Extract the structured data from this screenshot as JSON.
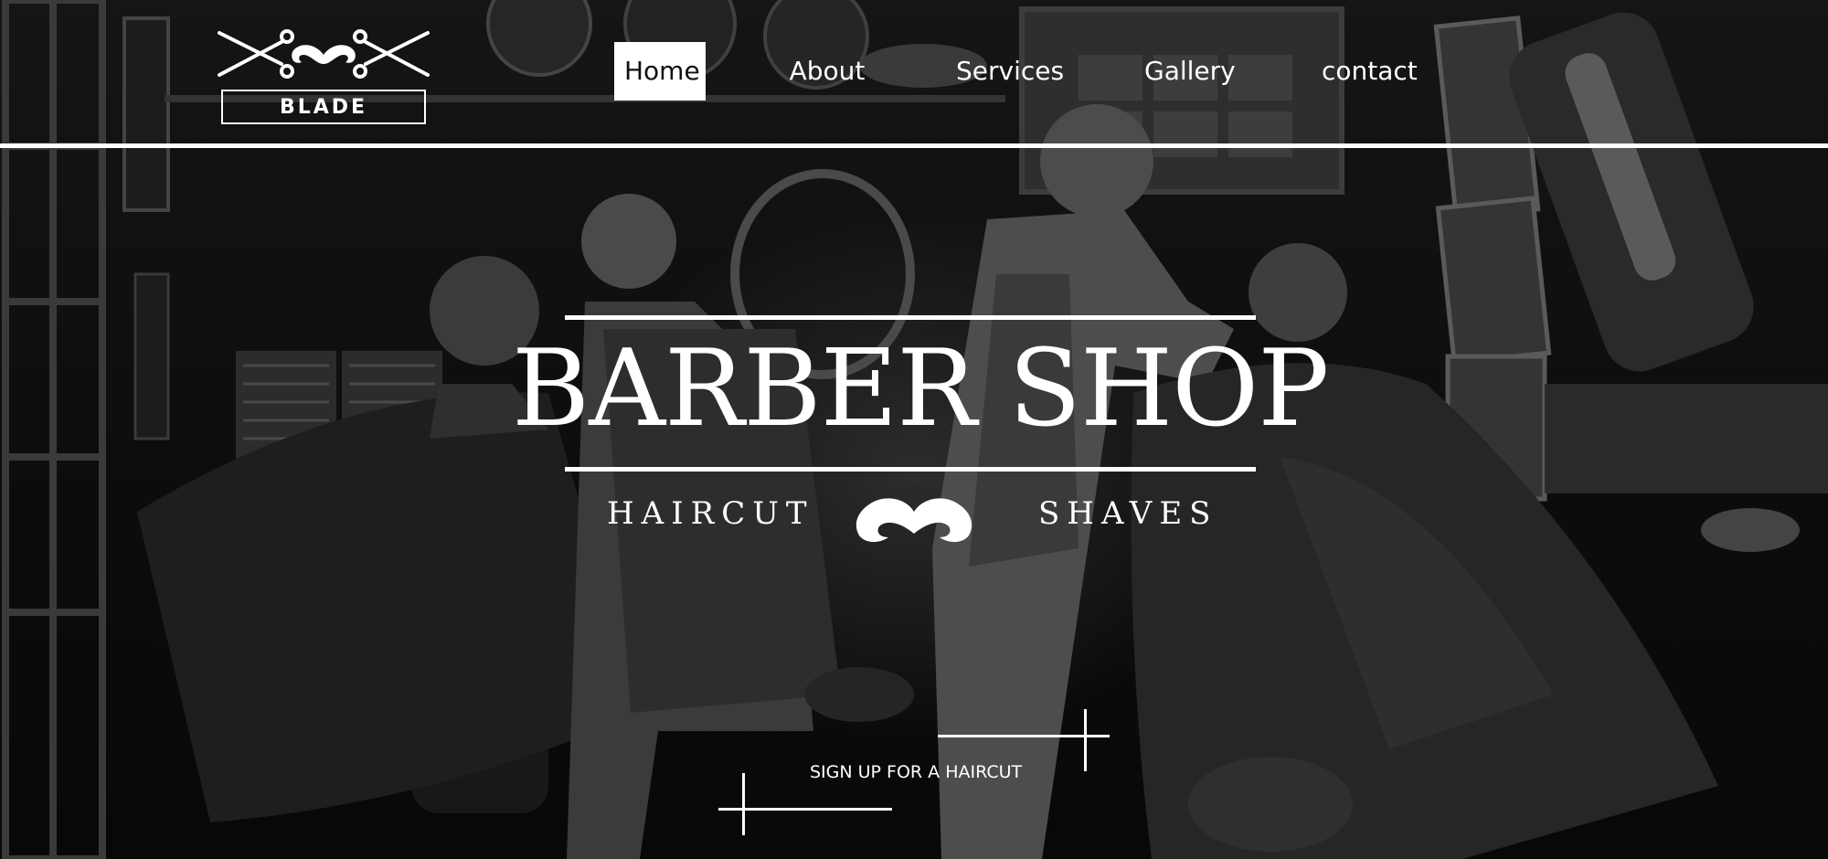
{
  "brand": {
    "logo_text": "BLADE"
  },
  "nav": {
    "items": [
      {
        "label": "Home",
        "active": true
      },
      {
        "label": "About",
        "active": false
      },
      {
        "label": "Services",
        "active": false
      },
      {
        "label": "Gallery",
        "active": false
      },
      {
        "label": "contact",
        "active": false
      }
    ]
  },
  "hero": {
    "title": "BARBER SHOP",
    "left_tagline": "HAIRCUT",
    "right_tagline": "SHAVES",
    "cta_label": "SIGN UP FOR A HAIRCUT"
  },
  "icons": {
    "logo": "scissors-mustache-logo-icon",
    "divider": "mustache-icon",
    "background": "barbershop-photo"
  },
  "colors": {
    "text": "#ffffff",
    "active_nav_bg": "#ffffff",
    "active_nav_text": "#111111",
    "background": "#111111"
  }
}
